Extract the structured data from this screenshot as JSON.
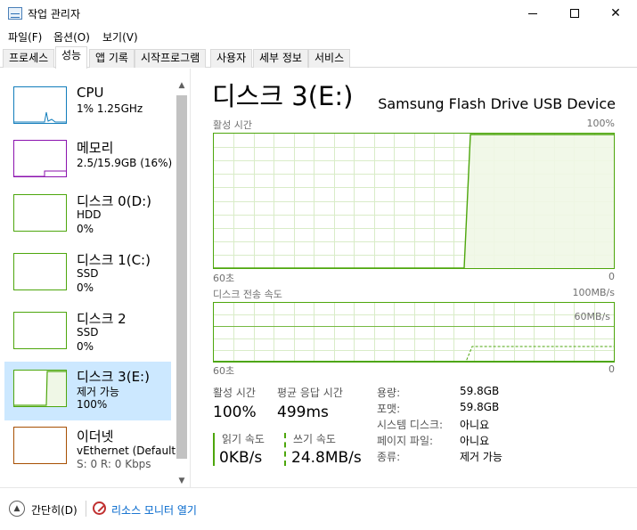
{
  "window": {
    "title": "작업 관리자"
  },
  "menu": [
    "파일(F)",
    "옵션(O)",
    "보기(V)"
  ],
  "tabs": [
    "프로세스",
    "성능",
    "앱 기록",
    "시작프로그램",
    "사용자",
    "세부 정보",
    "서비스"
  ],
  "active_tab": "성능",
  "sidebar": {
    "items": [
      {
        "title": "CPU",
        "line1": "1% 1.25GHz",
        "line2": "",
        "color": "#117dbb"
      },
      {
        "title": "메모리",
        "line1": "2.5/15.9GB (16%)",
        "line2": "",
        "color": "#8b12ae"
      },
      {
        "title": "디스크 0(D:)",
        "line1": "HDD",
        "line2": "0%",
        "color": "#4da60c"
      },
      {
        "title": "디스크 1(C:)",
        "line1": "SSD",
        "line2": "0%",
        "color": "#4da60c"
      },
      {
        "title": "디스크 2",
        "line1": "SSD",
        "line2": "0%",
        "color": "#4da60c"
      },
      {
        "title": "디스크 3(E:)",
        "line1": "제거 가능",
        "line2": "100%",
        "color": "#4da60c"
      },
      {
        "title": "이더넷",
        "line1": "vEthernet (Default...",
        "line2": "S: 0  R: 0 Kbps",
        "color": "#a74f01"
      }
    ],
    "selected_index": 5
  },
  "main": {
    "title": "디스크 3(E:)",
    "device": "Samsung Flash Drive USB Device",
    "active_time_graph": {
      "label": "활성 시간",
      "max_label": "100%",
      "time_left": "60초",
      "time_right": "0"
    },
    "transfer_graph": {
      "label": "디스크 전송 속도",
      "max_label": "100MB/s",
      "mid_label": "60MB/s",
      "time_left": "60초",
      "time_right": "0"
    },
    "stats": {
      "active_time_label": "활성 시간",
      "active_time_value": "100%",
      "avg_response_label": "평균 응답 시간",
      "avg_response_value": "499ms",
      "read_label": "읽기 속도",
      "read_value": "0KB/s",
      "write_label": "쓰기 속도",
      "write_value": "24.8MB/s"
    },
    "properties": [
      {
        "key": "용량:",
        "value": "59.8GB"
      },
      {
        "key": "포맷:",
        "value": "59.8GB"
      },
      {
        "key": "시스템 디스크:",
        "value": "아니요"
      },
      {
        "key": "페이지 파일:",
        "value": "아니요"
      },
      {
        "key": "종류:",
        "value": "제거 가능"
      }
    ]
  },
  "footer": {
    "collapse_label": "간단히(D)",
    "resource_monitor_label": "리소스 모니터 열기"
  },
  "colors": {
    "disk": "#4da60c",
    "disk_fill": "#eff7e6",
    "selected": "#cce8ff",
    "grid": "#d9ecc8"
  }
}
